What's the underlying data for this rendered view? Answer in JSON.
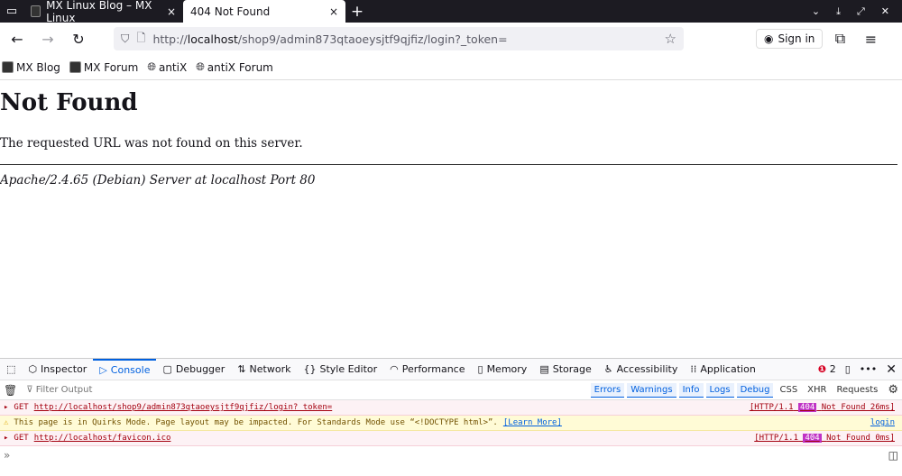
{
  "tabs": [
    {
      "title": "MX Linux Blog – MX Linux",
      "active": false
    },
    {
      "title": "404 Not Found",
      "active": true
    }
  ],
  "new_tab": "+",
  "url": {
    "scheme": "http://",
    "host": "localhost",
    "path": "/shop9/admin873qtaoeysjtf9qjfiz/login?_token="
  },
  "sign_in": "Sign in",
  "bookmarks": [
    {
      "label": "MX Blog",
      "icon": "mx-icon"
    },
    {
      "label": "MX Forum",
      "icon": "mx-icon"
    },
    {
      "label": "antiX",
      "icon": "globe-icon"
    },
    {
      "label": "antiX Forum",
      "icon": "globe-icon"
    }
  ],
  "page": {
    "heading": "Not Found",
    "message": "The requested URL was not found on this server.",
    "address": "Apache/2.4.65 (Debian) Server at localhost Port 80"
  },
  "devtools": {
    "tabs": [
      "Inspector",
      "Console",
      "Debugger",
      "Network",
      "Style Editor",
      "Performance",
      "Memory",
      "Storage",
      "Accessibility",
      "Application"
    ],
    "error_count": "2",
    "filter_placeholder": "Filter Output",
    "levels": [
      "Errors",
      "Warnings",
      "Info",
      "Logs",
      "Debug"
    ],
    "extra": [
      "CSS",
      "XHR",
      "Requests"
    ],
    "messages": [
      {
        "type": "error",
        "method": "GET",
        "url": "http://localhost/shop9/admin873qtaoeysjtf9qjfiz/login?_token=",
        "status_pre": "[HTTP/1.1",
        "status_code": "404",
        "status_post": "Not Found 26ms]"
      },
      {
        "type": "warning",
        "text": "This page is in Quirks Mode. Page layout may be impacted. For Standards Mode use “<!DOCTYPE html>”.",
        "link": "[Learn More]",
        "source": "login"
      },
      {
        "type": "error",
        "method": "GET",
        "url": "http://localhost/favicon.ico",
        "status_pre": "[HTTP/1.1",
        "status_code": "404",
        "status_post": "Not Found 0ms]"
      }
    ]
  }
}
